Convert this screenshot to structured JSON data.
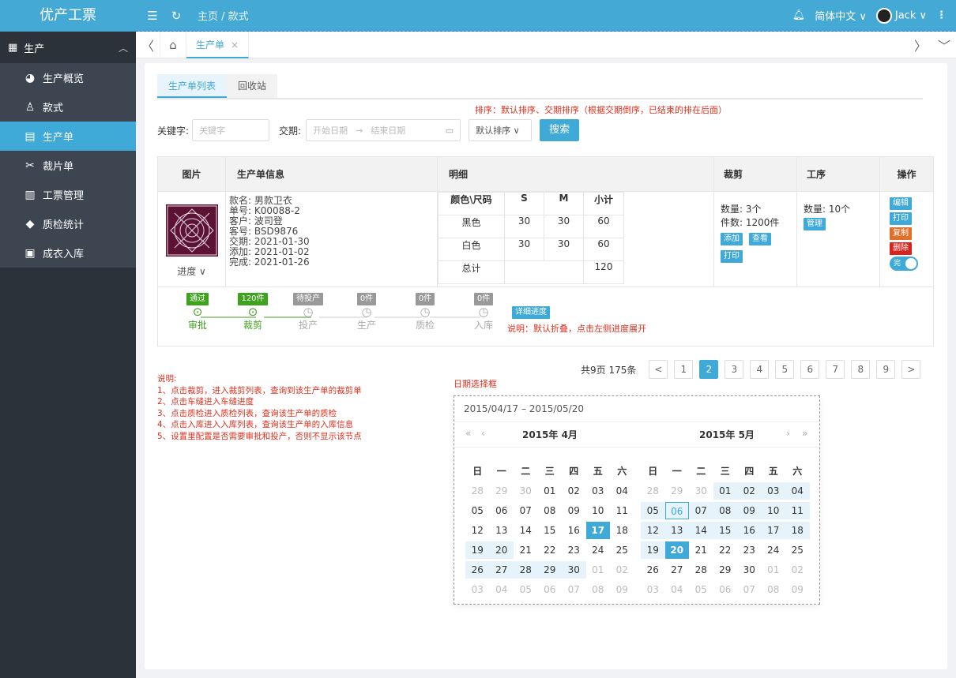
{
  "app": {
    "title": "优产工票"
  },
  "header": {
    "breadcrumb": "主页 / 款式",
    "language": "简体中文 ∨",
    "user": "Jack ∨"
  },
  "sidebar": {
    "group": "生产",
    "items": [
      {
        "label": "生产概览",
        "icon": "dashboard-icon"
      },
      {
        "label": "款式",
        "icon": "shirt-icon"
      },
      {
        "label": "生产单",
        "icon": "order-icon"
      },
      {
        "label": "裁片单",
        "icon": "scissors-icon"
      },
      {
        "label": "工票管理",
        "icon": "ticket-icon"
      },
      {
        "label": "质检统计",
        "icon": "shield-icon"
      },
      {
        "label": "成衣入库",
        "icon": "warehouse-icon"
      }
    ]
  },
  "tabs": {
    "open": "生产单"
  },
  "subtabs": [
    "生产单列表",
    "回收站"
  ],
  "notes": {
    "sort": "排序：默认排序、交期排序（根据交期倒序，已结束的排在后面）",
    "fold": "说明：默认折叠，点击左侧进度展开",
    "datepicker_title": "日期选择框",
    "explain": [
      "说明:",
      "1、点击裁剪，进入裁剪列表，查询到该生产单的裁剪单",
      "2、点击车缝进入车缝进度",
      "3、点击质检进入质检列表，查询该生产单的质检",
      "4、点击入库进入入库列表，查询该生产单的入库信息",
      "5、设置里配置是否需要审批和投产，否则不显示该节点"
    ]
  },
  "filter": {
    "keyword_label": "关键字:",
    "keyword_placeholder": "关键字",
    "date_label": "交期:",
    "start_placeholder": "开始日期",
    "arrow": "→",
    "end_placeholder": "结束日期",
    "sort": "默认排序 ∨",
    "search": "搜索"
  },
  "table": {
    "headers": [
      "图片",
      "生产单信息",
      "明细",
      "裁剪",
      "工序",
      "操作"
    ],
    "progress_label": "进度",
    "info": [
      "款名: 男款卫衣",
      "单号: K00088-2",
      "客户: 波司登",
      "客号: BSD9876",
      "交期: 2021-01-30",
      "添加: 2021-01-02",
      "完成: 2021-01-26"
    ],
    "detail": {
      "headers": [
        "颜色\\尺码",
        "S",
        "M",
        "小计"
      ],
      "rows": [
        [
          "黑色",
          "30",
          "30",
          "60"
        ],
        [
          "白色",
          "30",
          "30",
          "60"
        ]
      ],
      "total_label": "总计",
      "total": "120"
    },
    "cut": {
      "qty": "数量: 3个",
      "pieces": "件数: 1200件",
      "add": "添加",
      "view": "查看",
      "print": "打印"
    },
    "process": {
      "qty": "数量: 10个",
      "manage": "管理"
    },
    "actions": {
      "edit": "编辑",
      "print": "打印",
      "copy": "复制",
      "delete": "删除",
      "toggle": "完"
    },
    "steps": [
      {
        "tag": "通过",
        "label": "审批",
        "state": "done"
      },
      {
        "tag": "120件",
        "label": "裁剪",
        "state": "done"
      },
      {
        "tag": "待投产",
        "label": "投产",
        "state": "pending"
      },
      {
        "tag": "0件",
        "label": "生产",
        "state": "pending"
      },
      {
        "tag": "0件",
        "label": "质检",
        "state": "pending"
      },
      {
        "tag": "0件",
        "label": "入库",
        "state": "pending"
      }
    ],
    "detail_btn": "详细进度"
  },
  "pagination": {
    "summary": "共9页 175条",
    "pages": [
      "1",
      "2",
      "3",
      "4",
      "5",
      "6",
      "7",
      "8",
      "9"
    ],
    "current": "2",
    "prev": "<",
    "next": ">"
  },
  "datepicker": {
    "range": "2015/04/17  –  2015/05/20",
    "left_title": "2015年 4月",
    "right_title": "2015年 5月",
    "weekdays": [
      "日",
      "一",
      "二",
      "三",
      "四",
      "五",
      "六"
    ],
    "left": [
      [
        "28",
        "29",
        "30",
        "01",
        "02",
        "03",
        "04"
      ],
      [
        "05",
        "06",
        "07",
        "08",
        "09",
        "10",
        "11"
      ],
      [
        "12",
        "13",
        "14",
        "15",
        "16",
        "17",
        "18"
      ],
      [
        "19",
        "20",
        "21",
        "22",
        "23",
        "24",
        "25"
      ],
      [
        "26",
        "27",
        "28",
        "29",
        "30",
        "01",
        "02"
      ],
      [
        "03",
        "04",
        "05",
        "06",
        "07",
        "08",
        "09"
      ]
    ],
    "right": [
      [
        "28",
        "29",
        "30",
        "01",
        "02",
        "03",
        "04"
      ],
      [
        "05",
        "06",
        "07",
        "08",
        "09",
        "10",
        "11"
      ],
      [
        "12",
        "13",
        "14",
        "15",
        "16",
        "17",
        "18"
      ],
      [
        "19",
        "20",
        "21",
        "22",
        "23",
        "24",
        "25"
      ],
      [
        "26",
        "27",
        "28",
        "29",
        "30",
        "01",
        "02"
      ],
      [
        "03",
        "04",
        "05",
        "06",
        "07",
        "08",
        "09"
      ]
    ]
  }
}
